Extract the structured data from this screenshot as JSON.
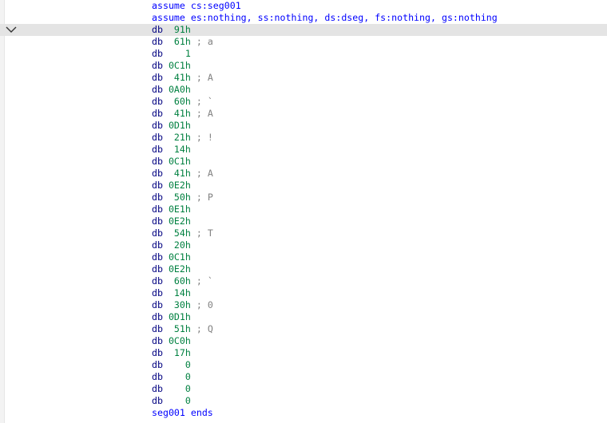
{
  "header_lines": [
    "assume cs:seg001",
    "assume es:nothing, ss:nothing, ds:dseg, fs:nothing, gs:nothing"
  ],
  "rows": [
    {
      "op": "db",
      "value": " 91h",
      "comment": ""
    },
    {
      "op": "db",
      "value": " 61h",
      "comment": " ; a"
    },
    {
      "op": "db",
      "value": "   1",
      "comment": ""
    },
    {
      "op": "db",
      "value": "0C1h",
      "comment": ""
    },
    {
      "op": "db",
      "value": " 41h",
      "comment": " ; A"
    },
    {
      "op": "db",
      "value": "0A0h",
      "comment": ""
    },
    {
      "op": "db",
      "value": " 60h",
      "comment": " ; `"
    },
    {
      "op": "db",
      "value": " 41h",
      "comment": " ; A"
    },
    {
      "op": "db",
      "value": "0D1h",
      "comment": ""
    },
    {
      "op": "db",
      "value": " 21h",
      "comment": " ; !"
    },
    {
      "op": "db",
      "value": " 14h",
      "comment": ""
    },
    {
      "op": "db",
      "value": "0C1h",
      "comment": ""
    },
    {
      "op": "db",
      "value": " 41h",
      "comment": " ; A"
    },
    {
      "op": "db",
      "value": "0E2h",
      "comment": ""
    },
    {
      "op": "db",
      "value": " 50h",
      "comment": " ; P"
    },
    {
      "op": "db",
      "value": "0E1h",
      "comment": ""
    },
    {
      "op": "db",
      "value": "0E2h",
      "comment": ""
    },
    {
      "op": "db",
      "value": " 54h",
      "comment": " ; T"
    },
    {
      "op": "db",
      "value": " 20h",
      "comment": ""
    },
    {
      "op": "db",
      "value": "0C1h",
      "comment": ""
    },
    {
      "op": "db",
      "value": "0E2h",
      "comment": ""
    },
    {
      "op": "db",
      "value": " 60h",
      "comment": " ; `"
    },
    {
      "op": "db",
      "value": " 14h",
      "comment": ""
    },
    {
      "op": "db",
      "value": " 30h",
      "comment": " ; 0"
    },
    {
      "op": "db",
      "value": "0D1h",
      "comment": ""
    },
    {
      "op": "db",
      "value": " 51h",
      "comment": " ; Q"
    },
    {
      "op": "db",
      "value": "0C0h",
      "comment": ""
    },
    {
      "op": "db",
      "value": " 17h",
      "comment": ""
    },
    {
      "op": "db",
      "value": "   0",
      "comment": ""
    },
    {
      "op": "db",
      "value": "   0",
      "comment": ""
    },
    {
      "op": "db",
      "value": "   0",
      "comment": ""
    },
    {
      "op": "db",
      "value": "   0",
      "comment": ""
    }
  ],
  "footer_line": "seg001 ends",
  "selected_row": 0,
  "colors": {
    "keyword": "#0000ff",
    "opcode": "#000080",
    "number": "#008040",
    "comment": "#808080",
    "highlight": "#e4e4e4"
  }
}
